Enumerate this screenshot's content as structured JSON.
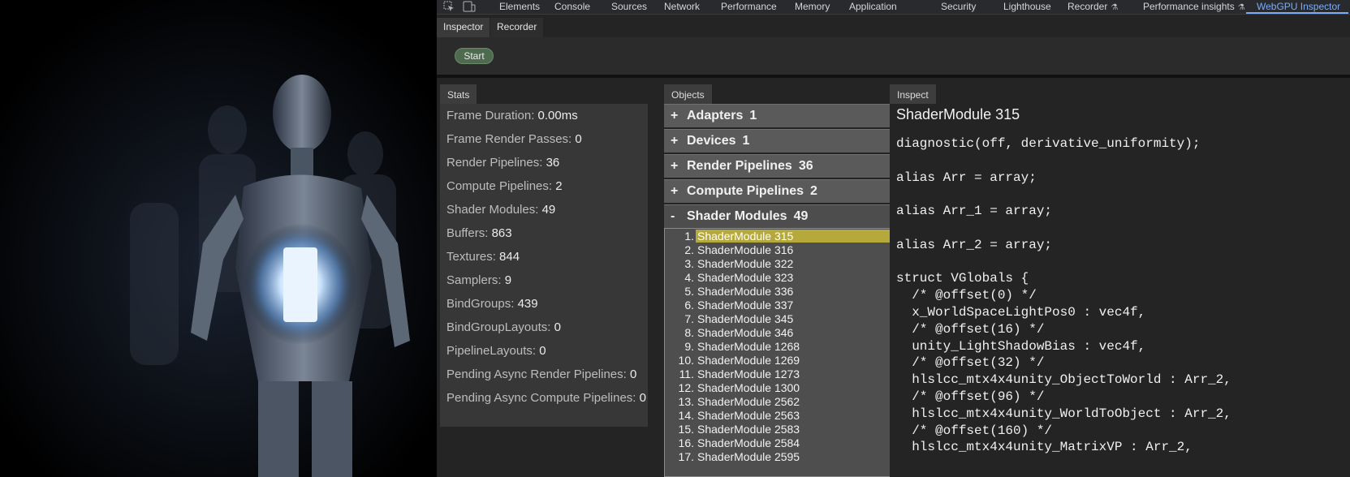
{
  "devtools_tabs": [
    "Elements",
    "Console",
    "Sources",
    "Network",
    "Performance",
    "Memory",
    "Application",
    "Security",
    "Lighthouse",
    "Recorder",
    "Performance insights",
    "WebGPU Inspector"
  ],
  "active_tab": "WebGPU Inspector",
  "icons": {
    "inspect": "inspect-element-icon",
    "device": "device-toolbar-icon",
    "flask": "flask-icon"
  },
  "sub_tabs": [
    "Inspector",
    "Recorder"
  ],
  "start_label": "Start",
  "panels": {
    "stats": "Stats",
    "objects": "Objects",
    "inspect": "Inspect"
  },
  "stats": [
    {
      "label": "Frame Duration:",
      "value": "0.00ms"
    },
    {
      "label": "Frame Render Passes:",
      "value": "0"
    },
    {
      "label": "Render Pipelines:",
      "value": "36"
    },
    {
      "label": "Compute Pipelines:",
      "value": "2"
    },
    {
      "label": "Shader Modules:",
      "value": "49"
    },
    {
      "label": "Buffers:",
      "value": "863"
    },
    {
      "label": "Textures:",
      "value": "844"
    },
    {
      "label": "Samplers:",
      "value": "9"
    },
    {
      "label": "BindGroups:",
      "value": "439"
    },
    {
      "label": "BindGroupLayouts:",
      "value": "0"
    },
    {
      "label": "PipelineLayouts:",
      "value": "0"
    },
    {
      "label": "Pending Async Render Pipelines:",
      "value": "0"
    },
    {
      "label": "Pending Async Compute Pipelines:",
      "value": "0"
    }
  ],
  "object_groups": [
    {
      "sign": "+",
      "name": "Adapters",
      "count": "1"
    },
    {
      "sign": "+",
      "name": "Devices",
      "count": "1"
    },
    {
      "sign": "+",
      "name": "Render Pipelines",
      "count": "36"
    },
    {
      "sign": "+",
      "name": "Compute Pipelines",
      "count": "2"
    },
    {
      "sign": "-",
      "name": "Shader Modules",
      "count": "49"
    }
  ],
  "shader_modules": [
    {
      "num": "1.",
      "name": "ShaderModule 315"
    },
    {
      "num": "2.",
      "name": "ShaderModule 316"
    },
    {
      "num": "3.",
      "name": "ShaderModule 322"
    },
    {
      "num": "4.",
      "name": "ShaderModule 323"
    },
    {
      "num": "5.",
      "name": "ShaderModule 336"
    },
    {
      "num": "6.",
      "name": "ShaderModule 337"
    },
    {
      "num": "7.",
      "name": "ShaderModule 345"
    },
    {
      "num": "8.",
      "name": "ShaderModule 346"
    },
    {
      "num": "9.",
      "name": "ShaderModule 1268"
    },
    {
      "num": "10.",
      "name": "ShaderModule 1269"
    },
    {
      "num": "11.",
      "name": "ShaderModule 1273"
    },
    {
      "num": "12.",
      "name": "ShaderModule 1300"
    },
    {
      "num": "13.",
      "name": "ShaderModule 2562"
    },
    {
      "num": "14.",
      "name": "ShaderModule 2563"
    },
    {
      "num": "15.",
      "name": "ShaderModule 2583"
    },
    {
      "num": "16.",
      "name": "ShaderModule 2584"
    },
    {
      "num": "17.",
      "name": "ShaderModule 2595"
    }
  ],
  "selected_module": "ShaderModule 315",
  "inspect_title": "ShaderModule 315",
  "code_lines": [
    "diagnostic(off, derivative_uniformity);",
    "",
    "alias Arr = array;",
    "",
    "alias Arr_1 = array;",
    "",
    "alias Arr_2 = array;",
    "",
    "struct VGlobals {",
    "  /* @offset(0) */",
    "  x_WorldSpaceLightPos0 : vec4f,",
    "  /* @offset(16) */",
    "  unity_LightShadowBias : vec4f,",
    "  /* @offset(32) */",
    "  hlslcc_mtx4x4unity_ObjectToWorld : Arr_2,",
    "  /* @offset(96) */",
    "  hlslcc_mtx4x4unity_WorldToObject : Arr_2,",
    "  /* @offset(160) */",
    "  hlslcc_mtx4x4unity_MatrixVP : Arr_2,"
  ],
  "colors": {
    "accent": "#7cacf8",
    "selection": "#b5a93c",
    "start_button": "#4e6b4f"
  }
}
